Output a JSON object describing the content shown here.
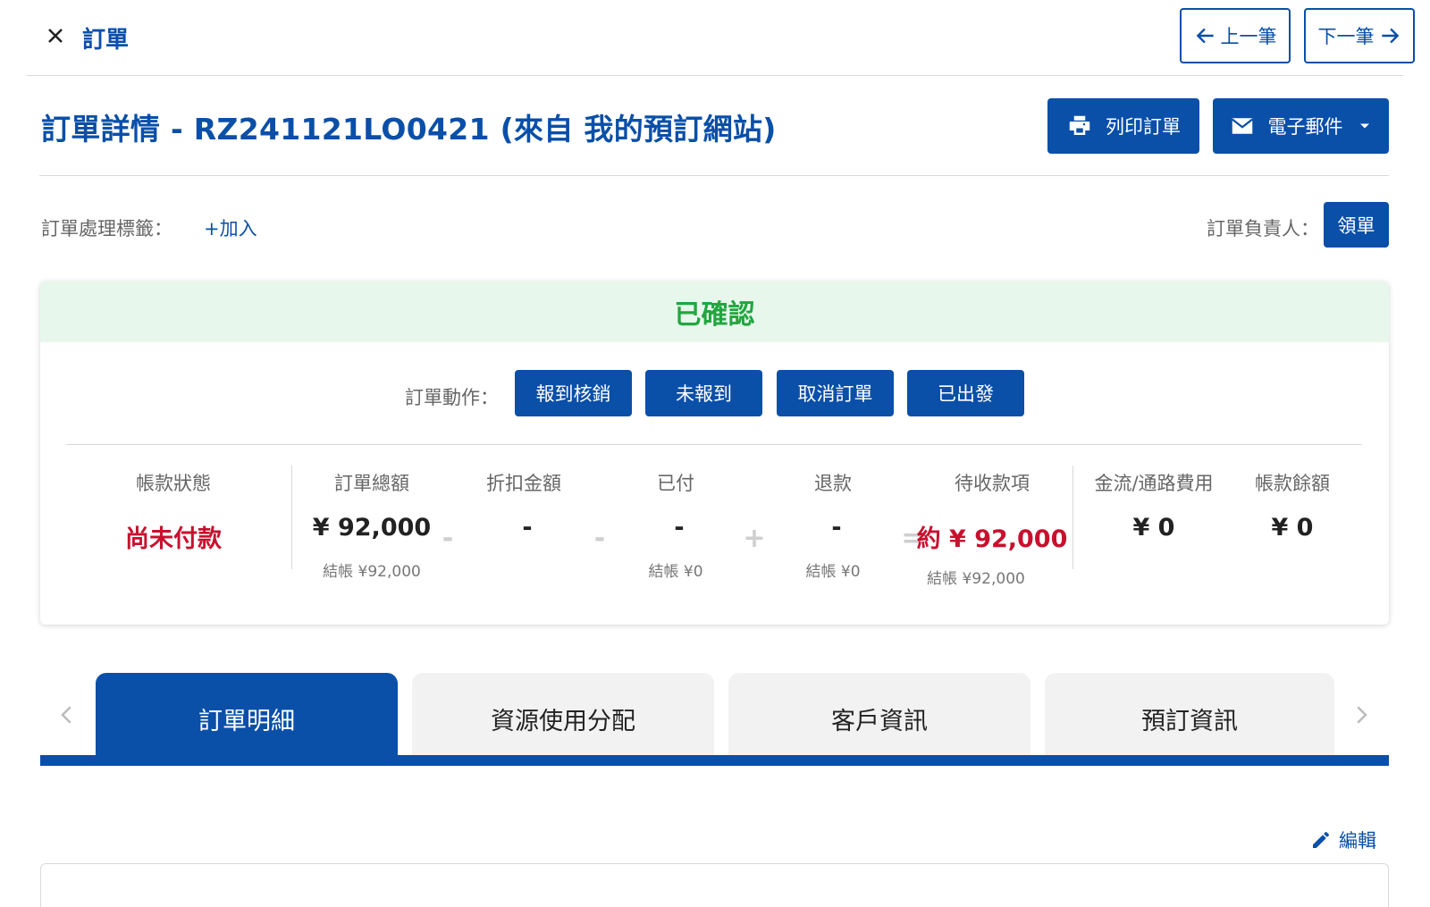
{
  "topbar": {
    "title": "訂單",
    "prev_label": "上一筆",
    "next_label": "下一筆"
  },
  "header": {
    "title": "訂單詳情  - RZ241121LO0421 (來自 我的預訂網站)",
    "print_label": "列印訂單",
    "email_label": "電子郵件"
  },
  "tags": {
    "label": "訂單處理標籤：",
    "add_label": "+加入",
    "owner_label": "訂單負責人：",
    "claim_label": "領單"
  },
  "status": {
    "text": "已確認",
    "color": "#22a63f",
    "actions_label": "訂單動作：",
    "actions": [
      "報到核銷",
      "未報到",
      "取消訂單",
      "已出發"
    ]
  },
  "summary": {
    "account_status": {
      "label": "帳款狀態",
      "value": "尚未付款"
    },
    "order_total": {
      "label": "訂單總額",
      "value": "¥ 92,000",
      "sub": "結帳 ¥92,000"
    },
    "discount": {
      "label": "折扣金額",
      "value": "-"
    },
    "paid": {
      "label": "已付",
      "value": "-",
      "sub": "結帳 ¥0"
    },
    "refund": {
      "label": "退款",
      "value": "-",
      "sub": "結帳 ¥0"
    },
    "receivable": {
      "label": "待收款項",
      "value": "約 ¥ 92,000",
      "sub": "結帳 ¥92,000"
    },
    "fees": {
      "label": "金流/通路費用",
      "value": "¥ 0"
    },
    "balance": {
      "label": "帳款餘額",
      "value": "¥ 0"
    },
    "ops": {
      "minus1": "-",
      "minus2": "-",
      "plus": "+",
      "equals": "="
    }
  },
  "tabs": [
    {
      "label": "訂單明細",
      "active": true
    },
    {
      "label": "資源使用分配",
      "active": false
    },
    {
      "label": "客戶資訊",
      "active": false
    },
    {
      "label": "預訂資訊",
      "active": false
    }
  ],
  "edit": {
    "label": "編輯"
  },
  "colors": {
    "primary": "#0a4fa8",
    "danger": "#c8102e",
    "success": "#22a63f"
  }
}
